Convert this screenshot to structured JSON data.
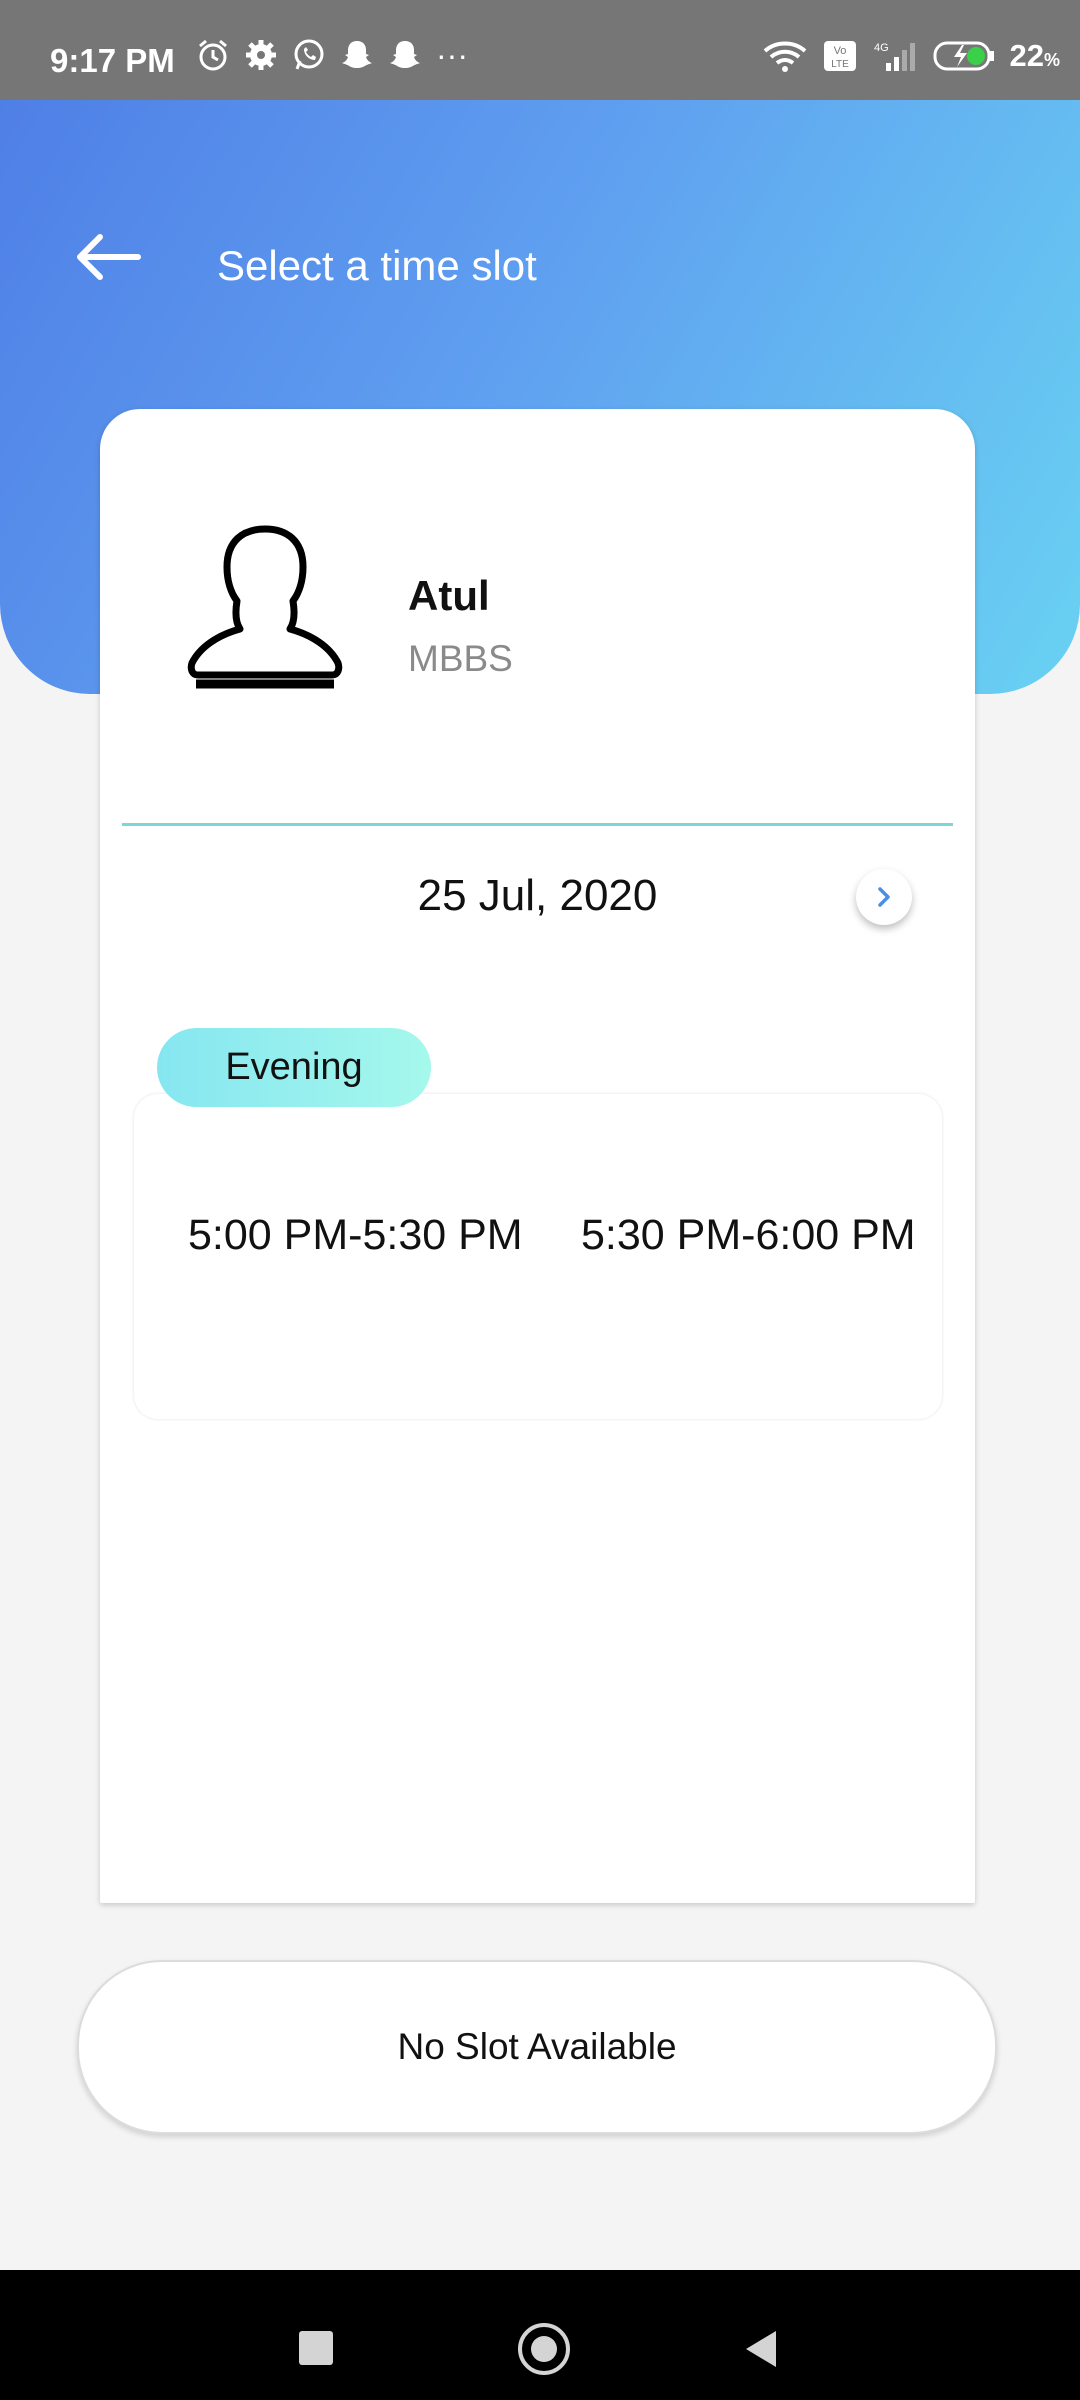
{
  "status_bar": {
    "time": "9:17 PM",
    "more": "···",
    "network": "4G",
    "volte": "Vo LTE",
    "battery": "22",
    "battery_unit": "%"
  },
  "header": {
    "title": "Select a time slot"
  },
  "doctor": {
    "name": "Atul",
    "degree": "MBBS"
  },
  "schedule": {
    "date": "25 Jul, 2020",
    "session": "Evening",
    "slots": [
      "5:00 PM-5:30 PM",
      "5:30 PM-6:00 PM"
    ]
  },
  "action": {
    "label": "No Slot Available"
  },
  "colors": {
    "header_gradient_start": "#4f7fe6",
    "header_gradient_end": "#69d2f2",
    "divider": "#7fd6d6",
    "session_pill": "#86e6f0",
    "next_arrow": "#4a8ee8"
  }
}
